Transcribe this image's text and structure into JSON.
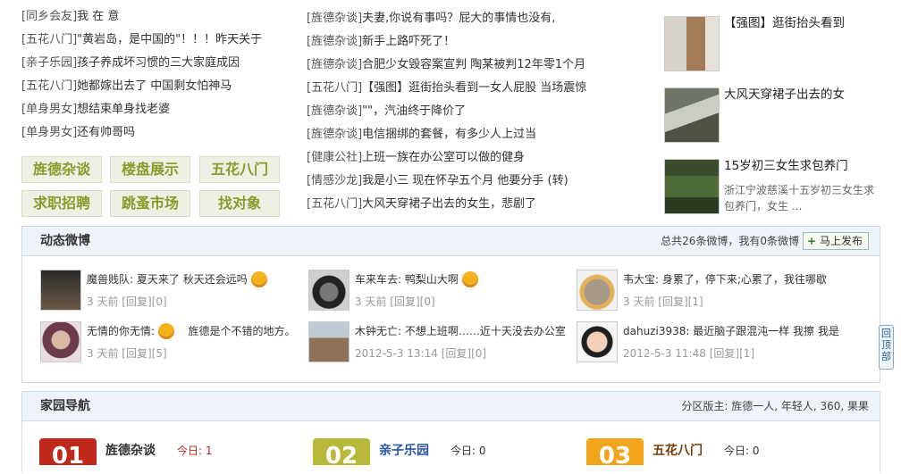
{
  "left_list": [
    {
      "tag": "[同乡会友]",
      "title": "我 在 意"
    },
    {
      "tag": "[五花八门]",
      "title": "\"黄岩岛，是中国的\"！！！昨天关于"
    },
    {
      "tag": "[亲子乐园]",
      "title": "孩子养成坏习惯的三大家庭成因"
    },
    {
      "tag": "[五花八门]",
      "title": "她都嫁出去了 中国剩女怕神马"
    },
    {
      "tag": "[单身男女]",
      "title": "想结束单身找老婆"
    },
    {
      "tag": "[单身男女]",
      "title": "还有帅哥吗"
    }
  ],
  "quick_links": [
    "旌德杂谈",
    "楼盘展示",
    "五花八门",
    "求职招聘",
    "跳蚤市场",
    "找对象"
  ],
  "mid_list": [
    {
      "tag": "[旌德杂谈]",
      "title": "夫妻,你说有事吗？屁大的事情也没有,"
    },
    {
      "tag": "[旌德杂谈]",
      "title": "新手上路吓死了！"
    },
    {
      "tag": "[旌德杂谈]",
      "title": "合肥少女毁容案宣判 陶某被判12年零1个月"
    },
    {
      "tag": "[五花八门]",
      "title": "【强图】逛街抬头看到一女人屁股 当场震惊"
    },
    {
      "tag": "[旌德杂谈]",
      "title": "\"\"，汽油终于降价了"
    },
    {
      "tag": "[旌德杂谈]",
      "title": "电信捆绑的套餐，有多少人上过当"
    },
    {
      "tag": "[健康公社]",
      "title": "上班一族在办公室可以做的健身"
    },
    {
      "tag": "[情感沙龙]",
      "title": "我是小三 现在怀孕五个月 他要分手 (转)"
    },
    {
      "tag": "[五花八门]",
      "title": "大风天穿裙子出去的女生，悲剧了"
    }
  ],
  "image_news": [
    {
      "title": "【强图】逛街抬头看到",
      "desc": ""
    },
    {
      "title": "大风天穿裙子出去的女",
      "desc": ""
    },
    {
      "title": "15岁初三女生求包养门",
      "desc": "浙江宁波慈溪十五岁初三女生求包养门，女生 ..."
    }
  ],
  "weibo": {
    "title": "动态微博",
    "meta": "总共26条微博，我有0条微博",
    "post_label": "马上发布",
    "items": [
      {
        "user": "魔兽贱队",
        "text": "夏天来了  秋天还会远吗",
        "time": "3 天前",
        "reply": "[回复][0]"
      },
      {
        "user": "车来车去",
        "text": "鸭梨山大啊",
        "time": "3 天前",
        "reply": "[回复][0]"
      },
      {
        "user": "韦大宝",
        "text": "身累了，停下来;心累了，我往哪歇",
        "time": "3 天前",
        "reply": "[回复][1]"
      },
      {
        "user": "无情的你无情",
        "text": "旌德是个不错的地方。",
        "time": "3 天前",
        "reply": "[回复][5]"
      },
      {
        "user": "木钟无亡",
        "text": "不想上班啊……近十天没去办公室",
        "time": "2012-5-3 13:14",
        "reply": "[回复][0]"
      },
      {
        "user": "dahuzi3938",
        "text": "最近脑子跟混沌一样  我擦 我是",
        "time": "2012-5-3 11:48",
        "reply": "[回复][1]"
      }
    ]
  },
  "nav": {
    "title": "家园导航",
    "moderators": "分区版主: 旌德一人, 年轻人, 360, 果果",
    "items": [
      {
        "num": "01",
        "name": "旌德杂谈",
        "today_label": "今日:",
        "today_value": "1",
        "color": "#c0281c"
      },
      {
        "num": "02",
        "name": "亲子乐园",
        "today_label": "今日:",
        "today_value": "0",
        "color": "#b8b83a"
      },
      {
        "num": "03",
        "name": "五花八门",
        "today_label": "今日:",
        "today_value": "0",
        "color": "#f2a51a"
      }
    ]
  },
  "back_to_top": "回顶部"
}
